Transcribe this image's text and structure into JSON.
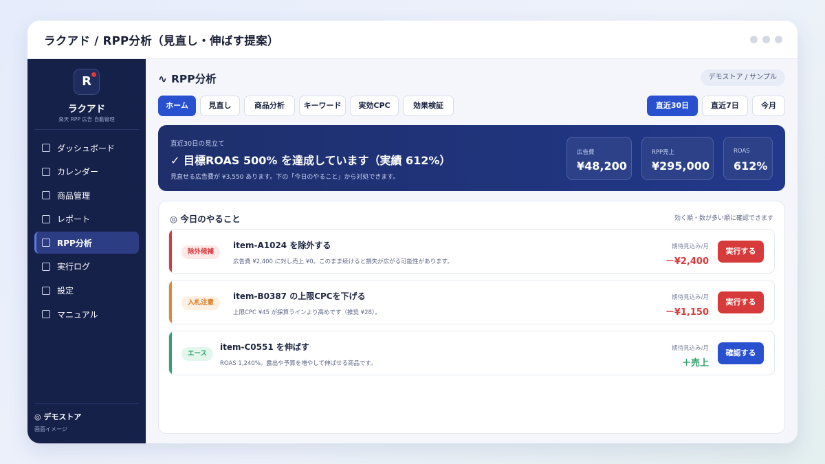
{
  "window": {
    "title": "ラクアド / RPP分析（見直し・伸ばす提案）"
  },
  "sidebar": {
    "logo_letter": "R",
    "brand": "ラクアド",
    "brand_sub": "楽天 RPP 広告 自動管理",
    "items": [
      {
        "label": "ダッシュボード",
        "active": false
      },
      {
        "label": "カレンダー",
        "active": false
      },
      {
        "label": "商品管理",
        "active": false
      },
      {
        "label": "レポート",
        "active": false
      },
      {
        "label": "RPP分析",
        "active": true
      },
      {
        "label": "実行ログ",
        "active": false
      },
      {
        "label": "設定",
        "active": false
      },
      {
        "label": "マニュアル",
        "active": false
      }
    ],
    "footer_name": "◎ デモストア",
    "footer_sub": "画面イメージ"
  },
  "header": {
    "icon": "∿",
    "title": "RPP分析",
    "store_chip": "デモストア / サンプル"
  },
  "tabs": [
    {
      "label": "ホーム",
      "active": true
    },
    {
      "label": "見直し",
      "active": false
    },
    {
      "label": "商品分析",
      "active": false
    },
    {
      "label": "キーワード",
      "active": false
    },
    {
      "label": "実効CPC",
      "active": false
    },
    {
      "label": "効果検証",
      "active": false
    }
  ],
  "period_tabs": [
    {
      "label": "直近30日",
      "active": true
    },
    {
      "label": "直近7日",
      "active": false
    },
    {
      "label": "今月",
      "active": false
    }
  ],
  "summary": {
    "label": "直近30日の見立て",
    "title": "✓ 目標ROAS 500% を達成しています（実績 612%）",
    "note": "見直せる広告費が ¥3,550 あります。下の「今日のやること」から対処できます。",
    "kpis": [
      {
        "label": "広告費",
        "value": "¥48,200"
      },
      {
        "label": "RPP売上",
        "value": "¥295,000"
      },
      {
        "label": "ROAS",
        "value": "612%"
      }
    ]
  },
  "todo": {
    "title": "◎ 今日のやること",
    "hint": "効く順・数が多い順に確認できます",
    "items": [
      {
        "badge": "除外候補",
        "title": "item-A1024 を除外する",
        "desc": "広告費 ¥2,400 に対し売上 ¥0。このまま続けると損失が広がる可能性があります。",
        "expected_label": "期待見込み/月",
        "expected_value": "－¥2,400",
        "action": "実行する",
        "accent": "#d63a3a"
      },
      {
        "badge": "入札注意",
        "title": "item-B0387 の上限CPCを下げる",
        "desc": "上限CPC ¥45 が採算ラインより高めです（推奨 ¥28）。",
        "expected_label": "期待見込み/月",
        "expected_value": "－¥1,150",
        "action": "実行する",
        "accent": "#e8862a"
      },
      {
        "badge": "エース",
        "title": "item-C0551 を伸ばす",
        "desc": "ROAS 1,240%。露出や予算を増やして伸ばせる商品です。",
        "expected_label": "期待見込み/月",
        "expected_value": "＋売上",
        "action": "確認する",
        "accent": "#2ea36a"
      }
    ]
  }
}
